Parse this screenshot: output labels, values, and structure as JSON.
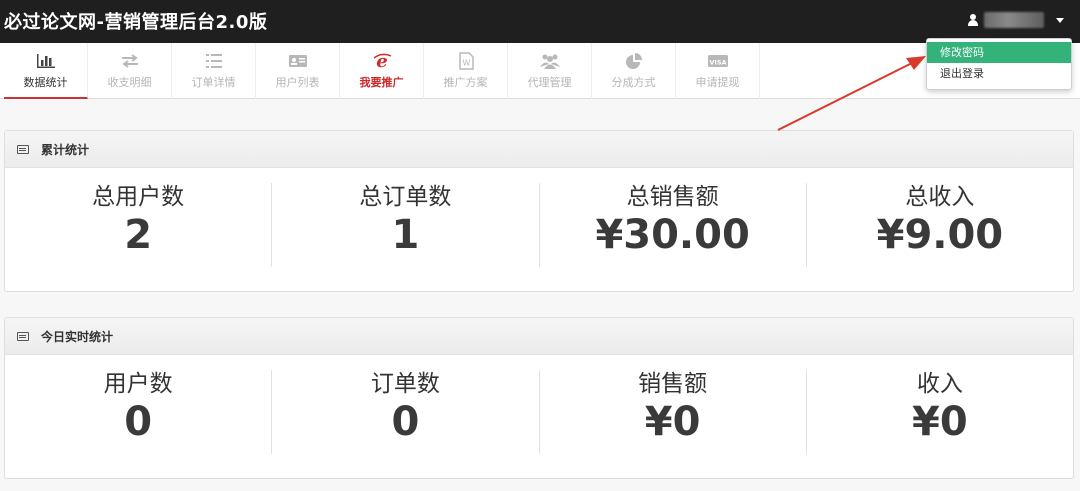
{
  "header": {
    "title": "必过论文网-营销管理后台2.0版"
  },
  "nav": {
    "tabs": [
      {
        "label": "数据统计",
        "icon": "bar-chart-icon"
      },
      {
        "label": "收支明细",
        "icon": "exchange-icon"
      },
      {
        "label": "订单详情",
        "icon": "list-icon"
      },
      {
        "label": "用户列表",
        "icon": "id-card-icon"
      },
      {
        "label": "我要推广",
        "icon": "ie-icon"
      },
      {
        "label": "推广方案",
        "icon": "word-doc-icon"
      },
      {
        "label": "代理管理",
        "icon": "users-icon"
      },
      {
        "label": "分成方式",
        "icon": "pie-chart-icon"
      },
      {
        "label": "申请提现",
        "icon": "visa-card-icon"
      }
    ]
  },
  "user_menu": {
    "items": [
      "修改密码",
      "退出登录"
    ],
    "highlight_color": "#33b27a"
  },
  "cumulative": {
    "title": "累计统计",
    "stats": [
      {
        "label": "总用户数",
        "value": "2"
      },
      {
        "label": "总订单数",
        "value": "1"
      },
      {
        "label": "总销售额",
        "value": "¥30.00"
      },
      {
        "label": "总收入",
        "value": "¥9.00"
      }
    ]
  },
  "today": {
    "title": "今日实时统计",
    "stats": [
      {
        "label": "用户数",
        "value": "0"
      },
      {
        "label": "订单数",
        "value": "0"
      },
      {
        "label": "销售额",
        "value": "¥0"
      },
      {
        "label": "收入",
        "value": "¥0"
      }
    ]
  },
  "colors": {
    "topbar": "#1f1f1f",
    "accent_red": "#cc2b2b",
    "arrow": "#d93a2e"
  }
}
